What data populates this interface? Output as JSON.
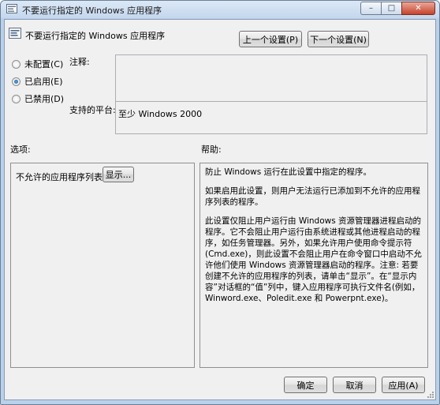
{
  "window": {
    "title": "不要运行指定的 Windows 应用程序",
    "caption": {
      "minimize": "–",
      "maximize": "□",
      "close": "✕"
    }
  },
  "header": {
    "title": "不要运行指定的 Windows 应用程序",
    "prev_label": "上一个设置(P)",
    "next_label": "下一个设置(N)"
  },
  "state": {
    "options": [
      {
        "label": "未配置(C)",
        "checked": false
      },
      {
        "label": "已启用(E)",
        "checked": true
      },
      {
        "label": "已禁用(D)",
        "checked": false
      }
    ]
  },
  "comment": {
    "label": "注释:",
    "value": ""
  },
  "platform": {
    "label": "支持的平台:",
    "value": "至少 Windows 2000"
  },
  "options_section": {
    "label": "选项:",
    "item_label": "不允许的应用程序列表",
    "show_button": "显示..."
  },
  "help_section": {
    "label": "帮助:",
    "paragraphs": [
      "防止 Windows 运行在此设置中指定的程序。",
      "如果启用此设置，则用户无法运行已添加到不允许的应用程序列表的程序。",
      "此设置仅阻止用户运行由 Windows 资源管理器进程启动的程序。它不会阻止用户运行由系统进程或其他进程启动的程序，如任务管理器。另外，如果允许用户使用命令提示符(Cmd.exe)，则此设置不会阻止用户在命令窗口中启动不允许他们使用 Windows 资源管理器启动的程序。注意: 若要创建不允许的应用程序的列表，请单击“显示”。在“显示内容”对话框的“值”列中，键入应用程序可执行文件名(例如，Winword.exe、Poledit.exe 和 Powerpnt.exe)。"
    ]
  },
  "footer": {
    "ok": "确定",
    "cancel": "取消",
    "apply": "应用(A)"
  }
}
